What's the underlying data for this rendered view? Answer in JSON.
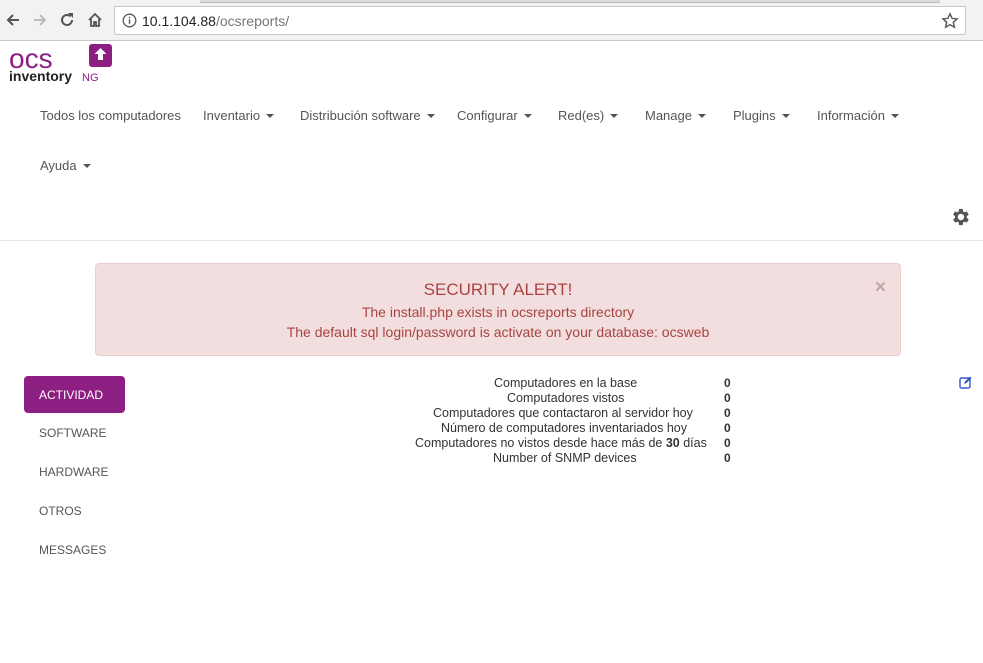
{
  "browser": {
    "url_host": "10.1.104.88",
    "url_path": "/ocsreports/"
  },
  "logo": {
    "text_top": "ocs",
    "text_bottom": "inventory",
    "text_suffix": "NG"
  },
  "menu": {
    "items": [
      {
        "label": "Todos los computadores",
        "has_caret": false
      },
      {
        "label": "Inventario",
        "has_caret": true
      },
      {
        "label": "Distribución software",
        "has_caret": true
      },
      {
        "label": "Configurar",
        "has_caret": true
      },
      {
        "label": "Red(es)",
        "has_caret": true
      },
      {
        "label": "Manage",
        "has_caret": true
      },
      {
        "label": "Plugins",
        "has_caret": true
      },
      {
        "label": "Información",
        "has_caret": true
      },
      {
        "label": "Ayuda",
        "has_caret": true
      }
    ]
  },
  "alert": {
    "title": "SECURITY ALERT!",
    "line1": "The install.php exists in ocsreports directory",
    "line2": "The default sql login/password is activate on your database: ocsweb",
    "close": "×"
  },
  "tabs": [
    {
      "label": "ACTIVIDAD",
      "active": true
    },
    {
      "label": "SOFTWARE",
      "active": false
    },
    {
      "label": "HARDWARE",
      "active": false
    },
    {
      "label": "OTROS",
      "active": false
    },
    {
      "label": "MESSAGES",
      "active": false
    }
  ],
  "stats": [
    {
      "label": "Computadores en la base",
      "value": "0"
    },
    {
      "label": "Computadores vistos",
      "value": "0"
    },
    {
      "label": "Computadores que contactaron al servidor hoy",
      "value": "0"
    },
    {
      "label": "Número de computadores inventariados hoy",
      "value": "0"
    },
    {
      "label_pre": "Computadores no vistos desde hace más de ",
      "label_num": "30",
      "label_post": " días",
      "value": "0"
    },
    {
      "label": "Number of SNMP devices",
      "value": "0"
    }
  ],
  "colors": {
    "brand": "#8e1f82",
    "alert_bg": "#f2dede",
    "alert_text": "#a94442",
    "edit_icon": "#3355cc"
  },
  "icons": [
    "back-icon",
    "forward-icon",
    "reload-icon",
    "home-icon",
    "info-icon",
    "star-icon",
    "gear-icon",
    "edit-icon"
  ]
}
